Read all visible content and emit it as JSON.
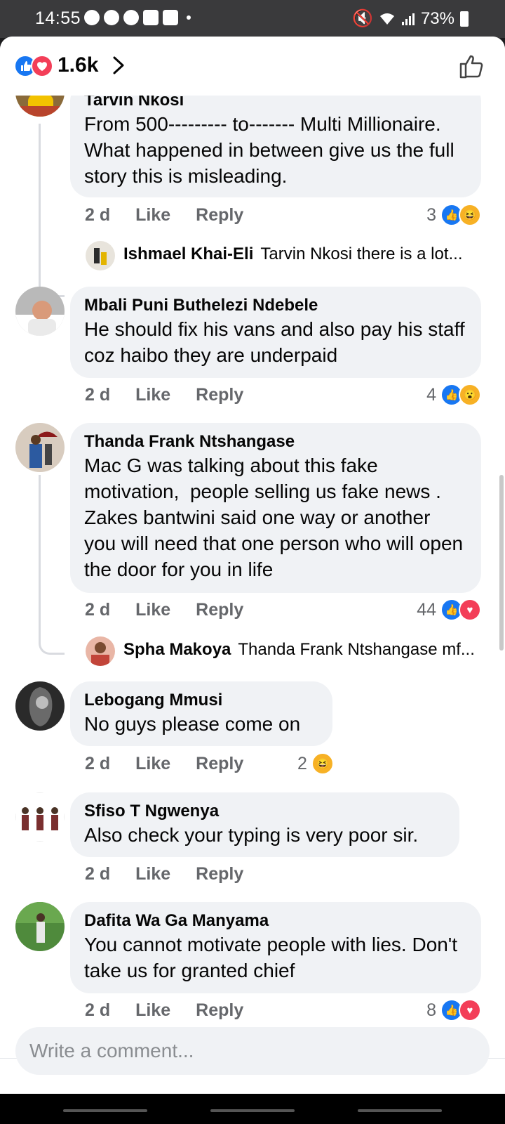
{
  "status_bar": {
    "time": "14:55",
    "battery": "73%"
  },
  "header": {
    "reaction_count": "1.6k"
  },
  "comments": [
    {
      "name": "Tarvin Nkosi",
      "text": "From 500--------- to------- Multi Millionaire. What happened in between give us the full story this is misleading.",
      "time": "2 d",
      "like": "Like",
      "reply": "Reply",
      "reaction_count": "3",
      "reactions": [
        "like",
        "haha"
      ],
      "reply_preview": {
        "name": "Ishmael Khai-Eli",
        "text": "Tarvin Nkosi there is a lot..."
      }
    },
    {
      "name": "Mbali Puni Buthelezi Ndebele",
      "text": "He should fix his vans and also pay his staff coz haibo they are underpaid",
      "time": "2 d",
      "like": "Like",
      "reply": "Reply",
      "reaction_count": "4",
      "reactions": [
        "like",
        "wow"
      ]
    },
    {
      "name": "Thanda Frank Ntshangase",
      "text": "Mac G was talking about this fake motivation,  people selling us fake news . Zakes bantwini said one way or another you will need that one person who will open the door for you in life",
      "time": "2 d",
      "like": "Like",
      "reply": "Reply",
      "reaction_count": "44",
      "reactions": [
        "like",
        "love"
      ],
      "reply_preview": {
        "name": "Spha Makoya",
        "text": "Thanda Frank Ntshangase mf..."
      }
    },
    {
      "name": "Lebogang Mmusi",
      "text": "No guys please come on",
      "time": "2 d",
      "like": "Like",
      "reply": "Reply",
      "reaction_count": "2",
      "reactions": [
        "haha"
      ]
    },
    {
      "name": "Sfiso T Ngwenya",
      "text": "Also check your typing is very poor sir.",
      "time": "2 d",
      "like": "Like",
      "reply": "Reply"
    },
    {
      "name": "Dafita Wa Ga Manyama",
      "text": "You cannot motivate people with lies. Don't take us for granted chief",
      "time": "2 d",
      "like": "Like",
      "reply": "Reply",
      "reaction_count": "8",
      "reactions": [
        "like",
        "love"
      ]
    }
  ],
  "composer": {
    "placeholder": "Write a comment..."
  },
  "colors": {
    "like_blue": "#1877f2",
    "love_red": "#f33e58",
    "bubble_gray": "#f0f2f5",
    "meta_gray": "#65676b"
  }
}
